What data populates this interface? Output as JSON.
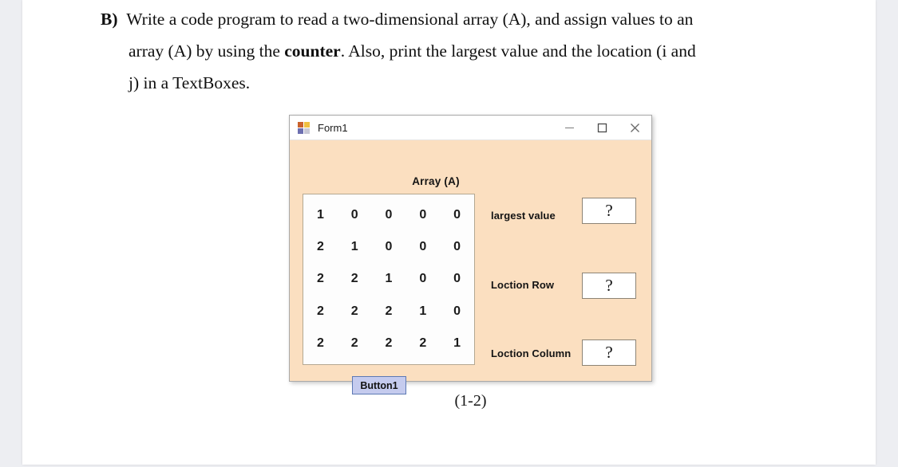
{
  "question": {
    "label": "B)",
    "line1_a": "Write a code program to read a two-dimensional array (A), and assign values to an",
    "line2_a": "array (A) by using the ",
    "line2_bold": "counter",
    "line2_b": ". Also, print the largest value and the location (i and",
    "line3": "j) in a TextBoxes."
  },
  "form": {
    "title": "Form1",
    "icon": "form-window-icon",
    "controls": {
      "minimize": "minimize-icon",
      "maximize": "maximize-icon",
      "close": "close-icon"
    },
    "array_label": "Array (A)",
    "array_rows": [
      [
        "1",
        "0",
        "0",
        "0",
        "0"
      ],
      [
        "2",
        "1",
        "0",
        "0",
        "0"
      ],
      [
        "2",
        "2",
        "1",
        "0",
        "0"
      ],
      [
        "2",
        "2",
        "2",
        "1",
        "0"
      ],
      [
        "2",
        "2",
        "2",
        "2",
        "1"
      ]
    ],
    "fields": [
      {
        "label": "largest value",
        "value": "?"
      },
      {
        "label": "Loction Row",
        "value": "?"
      },
      {
        "label": "Loction Column",
        "value": "?"
      }
    ],
    "button_label": "Button1"
  },
  "caption": "(1-2)",
  "colors": {
    "form_background": "#fbdfc0",
    "titlebar": "#ffffff",
    "button_fill": "#c5cbee",
    "button_border": "#5d79b4",
    "textbox_border": "#8d8475",
    "grid_border": "#b4a892",
    "page": "#ffffff",
    "canvas": "#edeef2"
  }
}
